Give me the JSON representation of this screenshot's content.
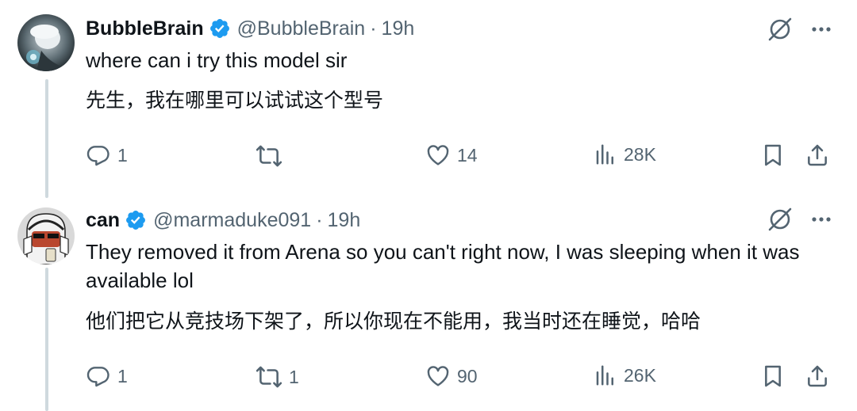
{
  "tweets": [
    {
      "name": "BubbleBrain",
      "handle": "@BubbleBrain",
      "separator": "·",
      "time": "19h",
      "text_en": "where can i try this model sir",
      "text_cn": "先生，我在哪里可以试试这个型号",
      "replies": "1",
      "retweets": "",
      "likes": "14",
      "views": "28K"
    },
    {
      "name": "can",
      "handle": "@marmaduke091",
      "separator": "·",
      "time": "19h",
      "text_en": "They removed it from Arena so you can't right now, I was sleeping when it was available lol",
      "text_cn": "他们把它从竞技场下架了，所以你现在不能用，我当时还在睡觉，哈哈",
      "replies": "1",
      "retweets": "1",
      "likes": "90",
      "views": "26K"
    }
  ],
  "colors": {
    "verified": "#1d9bf0",
    "secondary": "#536471",
    "thread_line": "#cfd9de"
  },
  "icons": [
    "verified-badge-icon",
    "grok-icon",
    "more-icon",
    "reply-icon",
    "retweet-icon",
    "like-icon",
    "views-icon",
    "bookmark-icon",
    "share-icon"
  ]
}
